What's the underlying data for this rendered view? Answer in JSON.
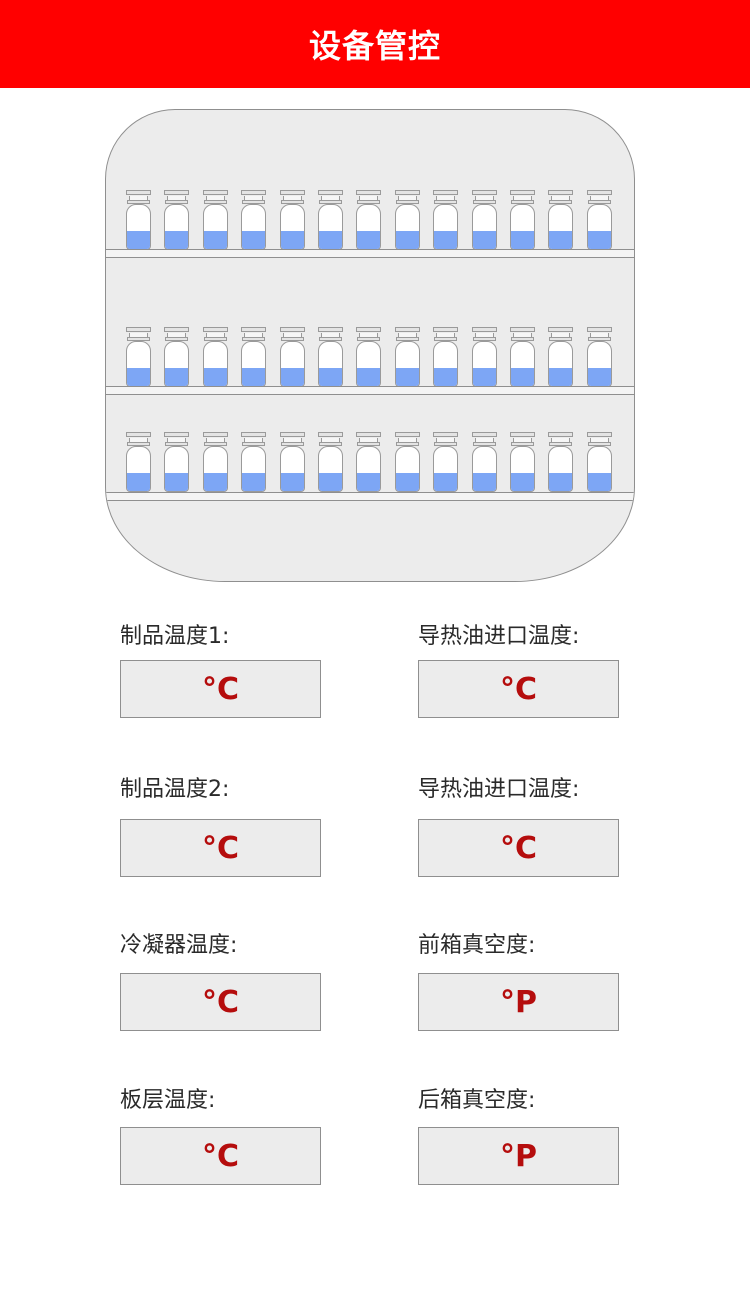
{
  "header": {
    "title": "设备管控",
    "background_color": "#ff0000"
  },
  "cabinet": {
    "shelves": [
      {
        "vial_count": 13,
        "fill_fraction": 0.4
      },
      {
        "vial_count": 13,
        "fill_fraction": 0.4
      },
      {
        "vial_count": 13,
        "fill_fraction": 0.4
      }
    ],
    "liquid_color": "#7da6f5"
  },
  "fields": [
    {
      "label": "制品温度1:",
      "value": "",
      "unit": "°C"
    },
    {
      "label": "导热油进口温度:",
      "value": "",
      "unit": "°C"
    },
    {
      "label": "制品温度2:",
      "value": "",
      "unit": "°C"
    },
    {
      "label": "导热油进口温度:",
      "value": "",
      "unit": "°C"
    },
    {
      "label": "冷凝器温度:",
      "value": "",
      "unit": "°C"
    },
    {
      "label": "前箱真空度:",
      "value": "",
      "unit": "°P"
    },
    {
      "label": "板层温度:",
      "value": "",
      "unit": "°C"
    },
    {
      "label": "后箱真空度:",
      "value": "",
      "unit": "°P"
    }
  ],
  "value_color": "#b50d0d"
}
